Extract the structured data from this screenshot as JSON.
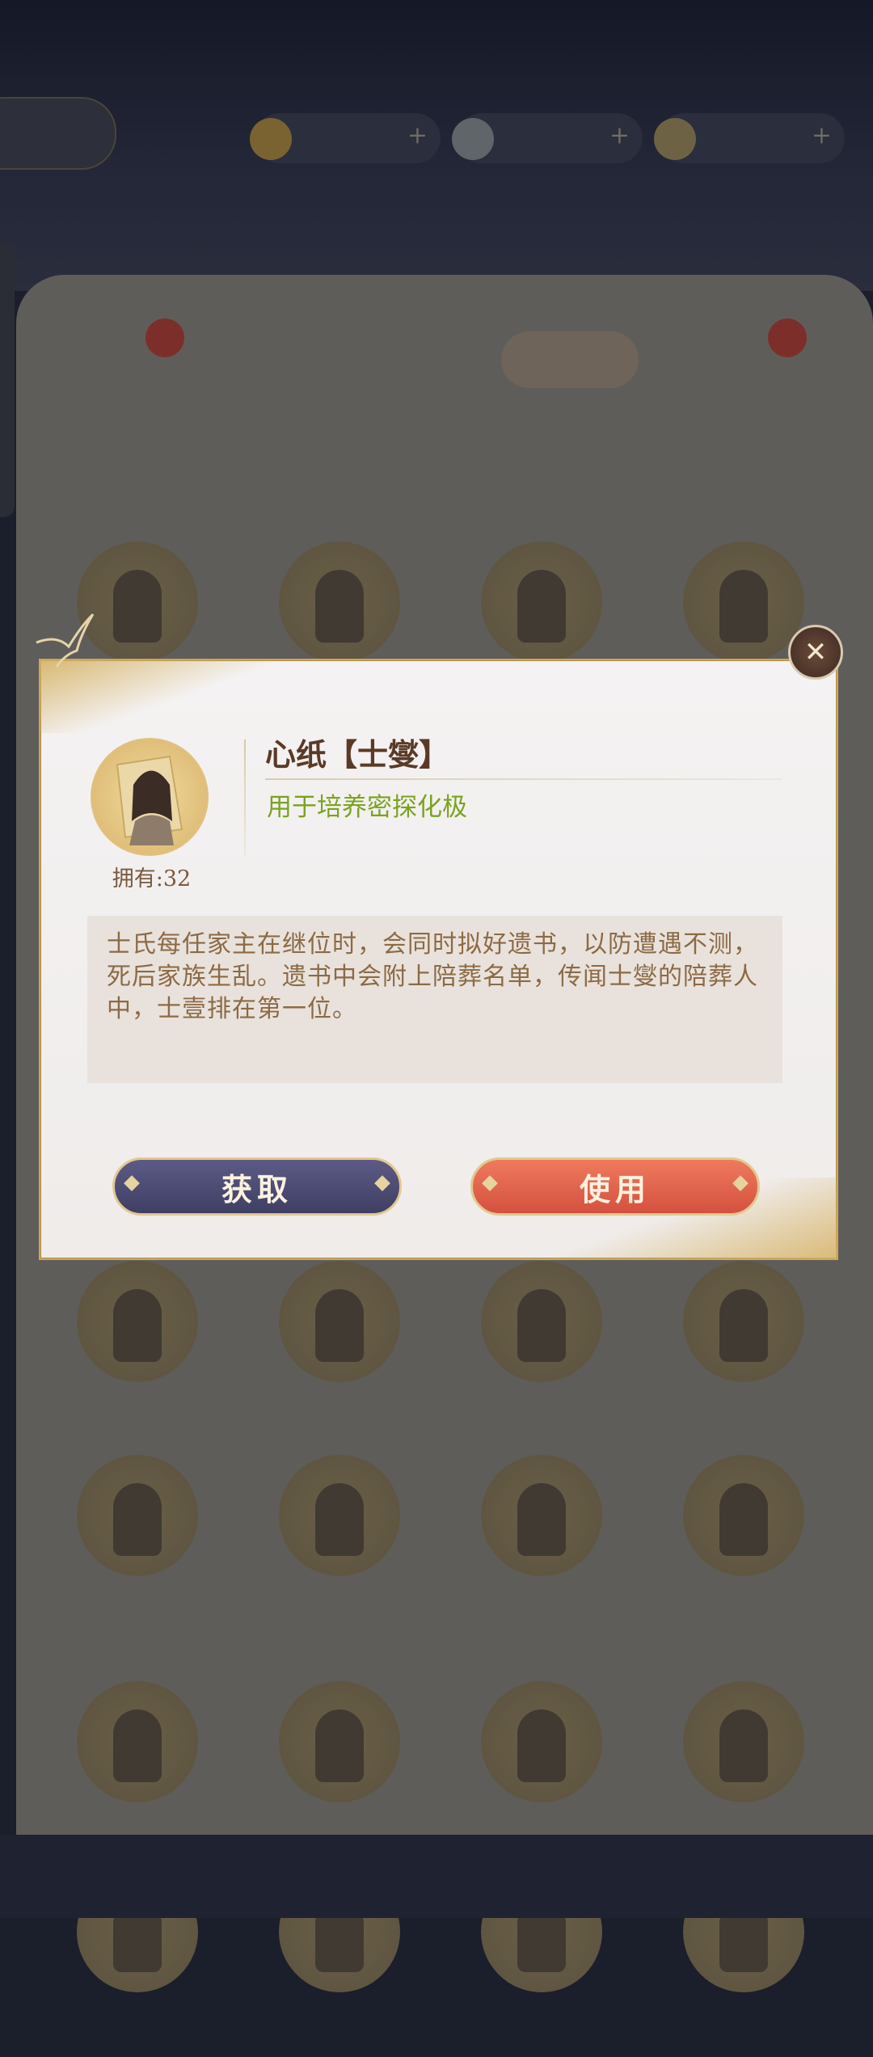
{
  "background": {
    "resources": [
      {
        "icon": "gold-coin-icon",
        "color": "#b08a3a"
      },
      {
        "icon": "silver-orb-icon",
        "color": "#9aa3a8"
      },
      {
        "icon": "ingot-icon",
        "color": "#c9b26c"
      }
    ],
    "tabs": [
      {
        "active": false,
        "badge": true
      },
      {
        "active": false,
        "badge": false
      },
      {
        "active": false,
        "badge": false
      },
      {
        "active": true,
        "badge": false
      },
      {
        "active": false,
        "badge": true
      }
    ]
  },
  "modal": {
    "item_name": "心纸【士燮】",
    "item_use": "用于培养密探化极",
    "owned_label": "拥有:32",
    "description": "士氏每任家主在继位时，会同时拟好遗书，以防遭遇不测，死后家族生乱。遗书中会附上陪葬名单，传闻士燮的陪葬人中，士壹排在第一位。",
    "get_label": "获取",
    "use_label": "使用",
    "close_icon": "close-icon"
  },
  "colors": {
    "name": "#5a3a26",
    "use_text": "#7aa31f",
    "description": "#8c6a45",
    "get_button": "#4d4c75",
    "use_button": "#e06548",
    "gold_border": "#c9a862"
  }
}
